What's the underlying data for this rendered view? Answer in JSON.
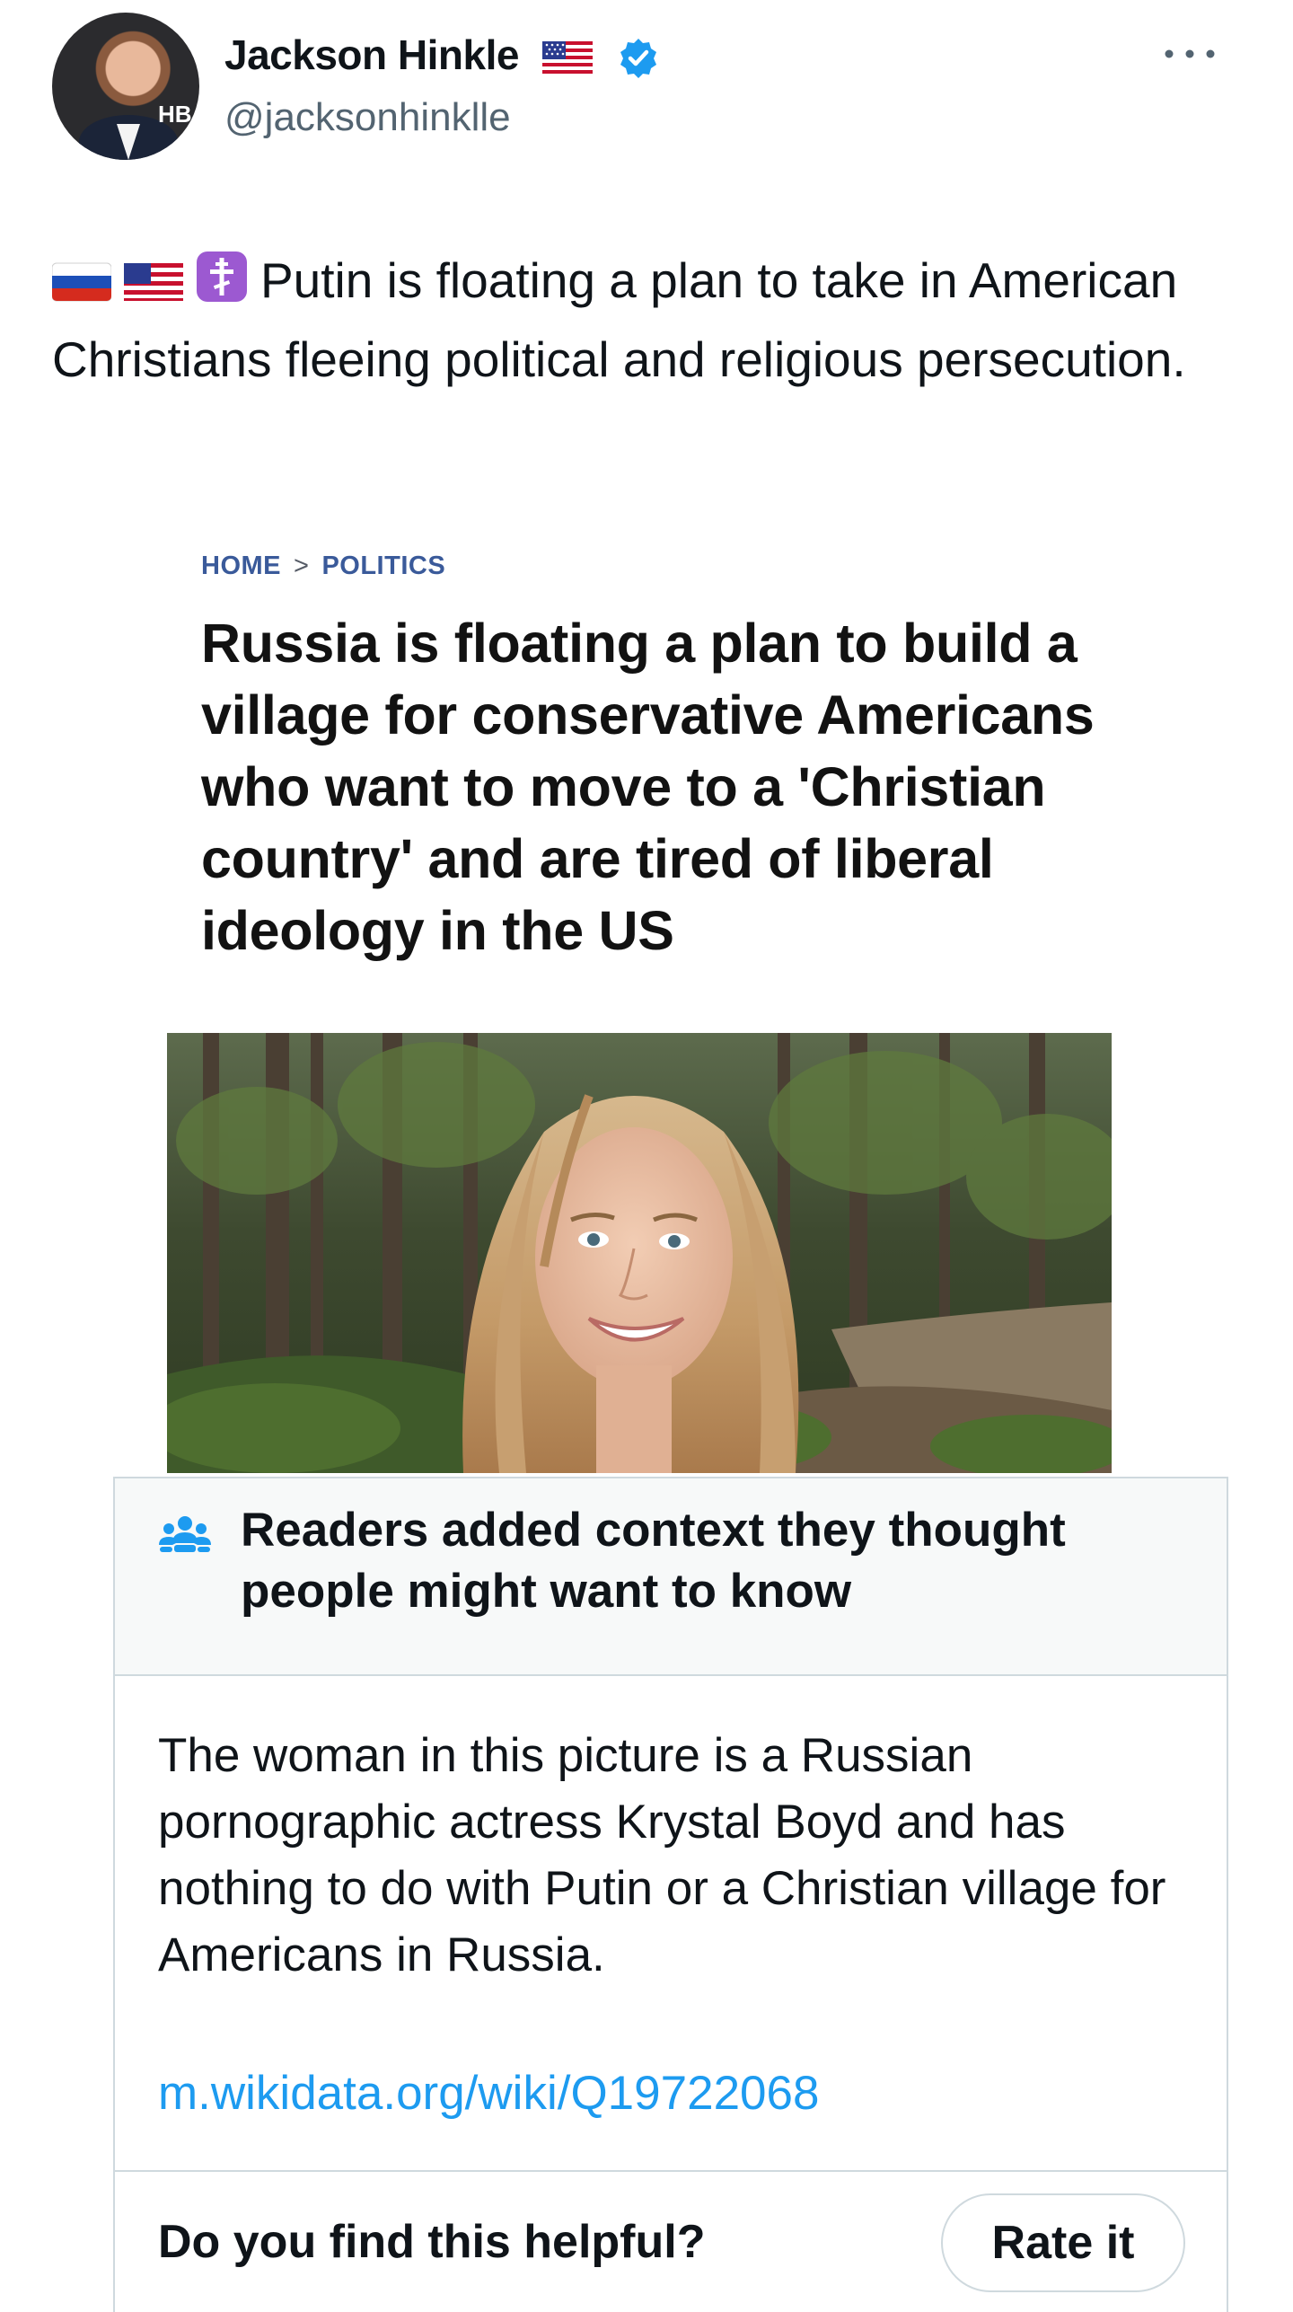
{
  "tweet": {
    "author": {
      "display_name": "Jackson Hinkle",
      "handle": "@jacksonhinklle",
      "avatar_badge_text": "HB",
      "verified": true,
      "name_emoji": "us-flag"
    },
    "more_icon": "more-horizontal-icon",
    "text_emojis": [
      "russia-flag",
      "us-flag",
      "orthodox-cross"
    ],
    "text": "Putin is floating a plan to take in American Christians fleeing political and religious persecution.",
    "article": {
      "breadcrumb": [
        "HOME",
        "POLITICS"
      ],
      "breadcrumb_separator": ">",
      "headline": "Russia is floating a plan to build a village for conservative Americans who want to move to a 'Christian country' and are tired of liberal ideology in the US",
      "image": "photo-woman-in-forest"
    },
    "community_note": {
      "icon": "people-icon",
      "title": "Readers added context they thought people might want to know",
      "body": "The woman in this picture is a Russian pornographic actress Krystal Boyd and has nothing to do with Putin or a Christian village for Americans in Russia.",
      "link": "m.wikidata.org/wiki/Q19722068",
      "helpful_prompt": "Do you find this helpful?",
      "rate_button": "Rate it"
    }
  },
  "colors": {
    "text_primary": "#0f1419",
    "text_secondary": "#536471",
    "link": "#1d9bf0",
    "verified": "#1d9bf0",
    "border": "#cfd9de",
    "note_header_bg": "#f7f9f9",
    "breadcrumb": "#3a5a9a"
  }
}
